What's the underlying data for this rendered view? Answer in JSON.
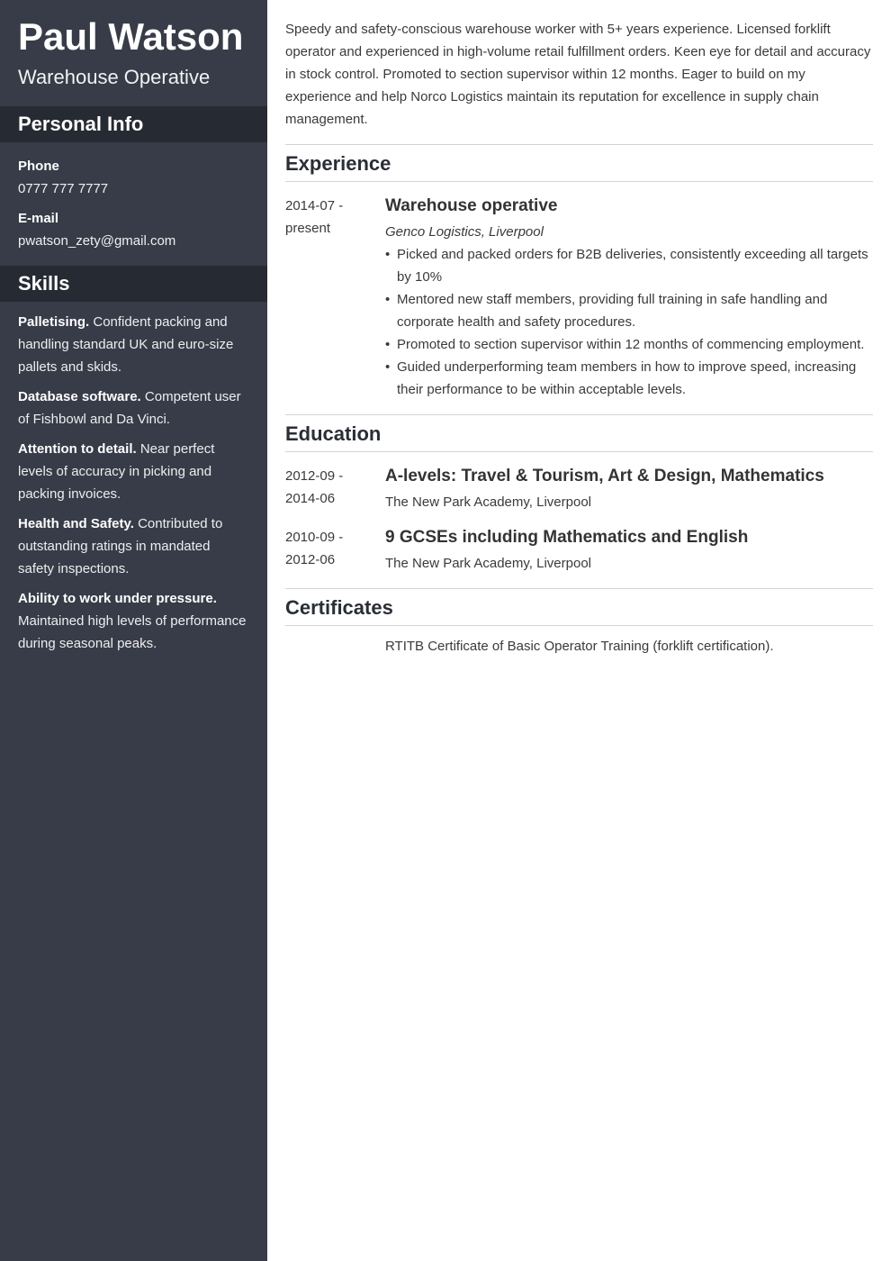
{
  "sidebar": {
    "name": "Paul Watson",
    "job_title": "Warehouse Operative",
    "personal_info": {
      "heading": "Personal Info",
      "phone_label": "Phone",
      "phone": "0777 777 7777",
      "email_label": "E-mail",
      "email": "pwatson_zety@gmail.com"
    },
    "skills": {
      "heading": "Skills",
      "items": [
        {
          "name": "Palletising.",
          "desc": " Confident packing and handling standard UK and euro-size pallets and skids."
        },
        {
          "name": "Database software.",
          "desc": " Competent user of Fishbowl and Da Vinci."
        },
        {
          "name": "Attention to detail.",
          "desc": " Near perfect levels of accuracy in picking and packing invoices."
        },
        {
          "name": "Health and Safety.",
          "desc": " Contributed to outstanding ratings in mandated safety inspections."
        },
        {
          "name": "Ability to work under pressure.",
          "desc": " Maintained high levels of performance during seasonal peaks."
        }
      ]
    }
  },
  "main": {
    "summary": "Speedy and safety-conscious warehouse worker with 5+ years experience. Licensed forklift operator and experienced in high-volume retail fulfillment orders. Keen eye for detail and accuracy in stock control. Promoted to section supervisor within 12 months. Eager to build on my experience and help Norco Logistics maintain its reputation for excellence in supply chain management.",
    "experience": {
      "heading": "Experience",
      "entries": [
        {
          "date_start": "2014-07 -",
          "date_end": "present",
          "title": "Warehouse operative",
          "company": "Genco Logistics, Liverpool",
          "bullets": [
            "Picked and packed orders for B2B deliveries, consistently exceeding all targets by 10%",
            "Mentored new staff members, providing full training in safe handling and corporate health and safety procedures.",
            "Promoted to section supervisor within 12 months of commencing employment.",
            "Guided underperforming team members in how to improve speed, increasing their performance to be within acceptable levels."
          ]
        }
      ]
    },
    "education": {
      "heading": "Education",
      "entries": [
        {
          "date_start": "2012-09 -",
          "date_end": "2014-06",
          "title": "A-levels: Travel & Tourism, Art & Design, Mathematics",
          "school": "The New Park Academy, Liverpool"
        },
        {
          "date_start": "2010-09 -",
          "date_end": "2012-06",
          "title": "9 GCSEs including Mathematics and English",
          "school": "The New Park Academy, Liverpool"
        }
      ]
    },
    "certificates": {
      "heading": "Certificates",
      "items": [
        "RTITB Certificate of Basic Operator Training (forklift certification)."
      ]
    },
    "bullet_glyph": "•"
  }
}
